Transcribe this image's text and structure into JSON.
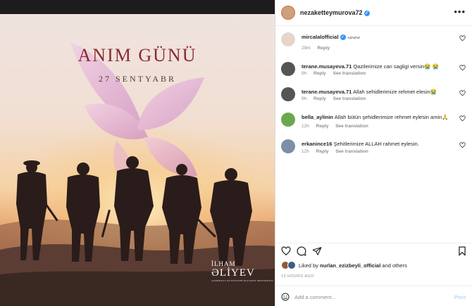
{
  "post": {
    "title": "ANIM GÜNÜ",
    "date": "27 SENTYABR",
    "signature_top": "İLHAM",
    "signature_name": "ƏLİYEV",
    "signature_sub": "AZƏRBAYCAN RESPUBLİKASININ PREZİDENTİ"
  },
  "header": {
    "username": "nezaketteymurova72",
    "verified": true
  },
  "comments": [
    {
      "user": "mircalalofficial",
      "verified": true,
      "flag": "AZAZAZ",
      "text": "",
      "time": "29m",
      "reply": "Reply",
      "translation": ""
    },
    {
      "user": "terane.musayeva.71",
      "text": "Qazilerimize can sagligi versin😭 😭",
      "time": "9h",
      "reply": "Reply",
      "translation": "See translation"
    },
    {
      "user": "terane.musayeva.71",
      "text": "Allah sehidlerimize rehmet elesin😭",
      "time": "9h",
      "reply": "Reply",
      "translation": "See translation"
    },
    {
      "user": "bella_aylinin",
      "text": "Allah bütün şehidlerimize rehmet eylesin amin🙏",
      "time": "12h",
      "reply": "Reply",
      "translation": "See translation"
    },
    {
      "user": "erkanince16",
      "text": "Şehitlerimize ALLAH rahmet eylesin.",
      "time": "12h",
      "reply": "Reply",
      "translation": "See translation"
    }
  ],
  "likes": {
    "prefix": "Liked by ",
    "user": "nurlan_ezizbeyli_official",
    "suffix": " and others"
  },
  "timestamp": "13 HOURS AGO",
  "add_comment": {
    "placeholder": "Add a comment...",
    "post_label": "Post"
  },
  "icons": {
    "like": "heart-icon",
    "comment": "comment-icon",
    "share": "share-icon",
    "save": "bookmark-icon",
    "emoji": "emoji-icon",
    "more": "more-icon"
  },
  "colors": {
    "title": "#8a2a2e",
    "verified": "#3897f0",
    "muted": "#8e8e8e",
    "post_button": "#b3dbff"
  }
}
